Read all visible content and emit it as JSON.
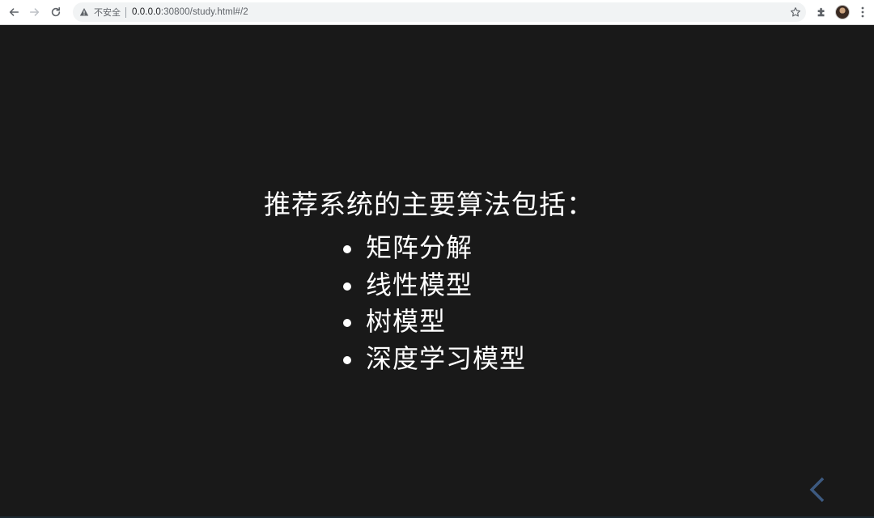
{
  "browser": {
    "security_label": "不安全",
    "url_host": "0.0.0.0",
    "url_rest": ":30800/study.html#/2",
    "icons": {
      "back": "arrow-left-icon",
      "forward": "arrow-right-icon",
      "reload": "reload-icon",
      "warning": "warning-icon",
      "bookmark": "star-icon",
      "extensions": "puzzle-icon",
      "menu": "more-vertical-icon"
    }
  },
  "slide": {
    "title": "推荐系统的主要算法包括：",
    "bullets": [
      "矩阵分解",
      "线性模型",
      "树模型",
      "深度学习模型"
    ],
    "background_color": "#191919",
    "text_color": "#ffffff",
    "control_color": "#3d5a80",
    "controls": {
      "prev_icon": "chevron-left-icon"
    }
  }
}
